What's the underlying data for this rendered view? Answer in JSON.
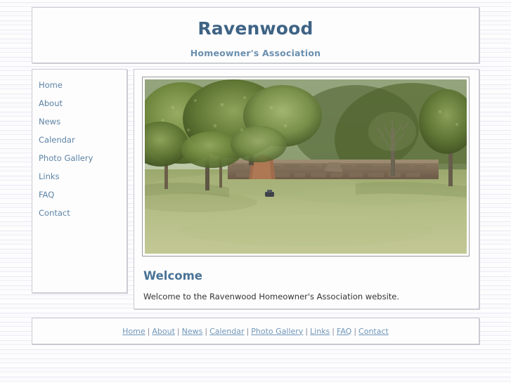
{
  "site": {
    "title": "Ravenwood",
    "subtitle": "Homeowner's Association"
  },
  "sidebar": {
    "items": [
      {
        "label": "Home"
      },
      {
        "label": "About"
      },
      {
        "label": "News"
      },
      {
        "label": "Calendar"
      },
      {
        "label": "Photo Gallery"
      },
      {
        "label": "Links"
      },
      {
        "label": "FAQ"
      },
      {
        "label": "Contact"
      }
    ]
  },
  "main": {
    "photo_alt": "Stone wall with green trees and grassy lawn",
    "heading": "Welcome",
    "paragraph": "Welcome to the Ravenwood Homeowner's Association website."
  },
  "footer": {
    "separator": "|",
    "links": [
      {
        "label": "Home"
      },
      {
        "label": "About"
      },
      {
        "label": "News"
      },
      {
        "label": "Calendar"
      },
      {
        "label": "Photo Gallery"
      },
      {
        "label": "Links"
      },
      {
        "label": "FAQ"
      },
      {
        "label": "Contact"
      }
    ]
  },
  "colors": {
    "title": "#3e6384",
    "subtitle": "#6a8fae",
    "link": "#5d83a4",
    "heading": "#4a7396",
    "body_text": "#333333",
    "panel_bg": "#fdfdfe",
    "panel_border": "#c9c9d2",
    "page_bg": "#fbfbfd"
  }
}
